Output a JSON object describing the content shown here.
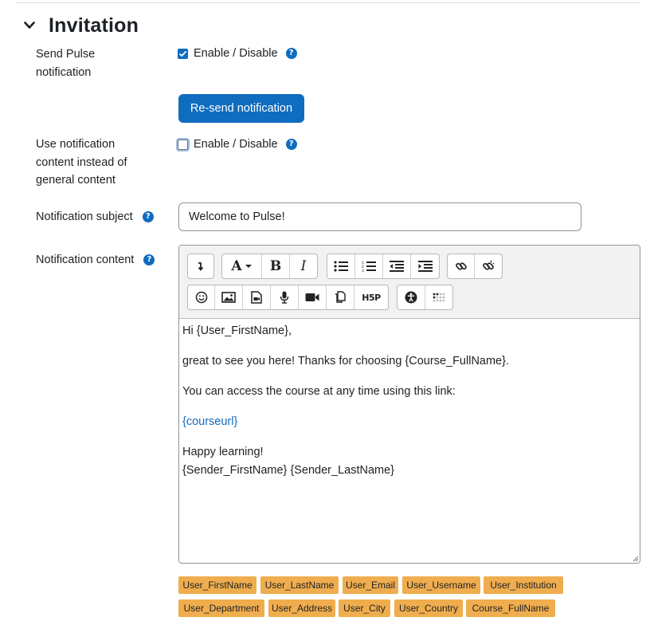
{
  "section": {
    "title": "Invitation"
  },
  "send_pulse": {
    "label": "Send Pulse notification",
    "checkbox_label": "Enable / Disable",
    "checked": true,
    "button_label": "Re-send notification"
  },
  "use_notification": {
    "label": "Use notification content instead of general content",
    "checkbox_label": "Enable / Disable",
    "checked": false
  },
  "subject": {
    "label": "Notification subject",
    "value": "Welcome to Pulse!"
  },
  "content": {
    "label": "Notification content",
    "greeting": "Hi {User_FirstName},",
    "line1": "great to see you here! Thanks for choosing {Course_FullName}.",
    "line2": "You can access the course at any time using this link:",
    "link": "{courseurl}",
    "closing": "Happy learning!",
    "signature": "{Sender_FirstName} {Sender_LastName}"
  },
  "toolbar": {
    "row1": [
      "collapse-icon",
      "font-color-icon",
      "bold-icon",
      "italic-icon",
      "unordered-list-icon",
      "ordered-list-icon",
      "outdent-icon",
      "indent-icon",
      "link-icon",
      "unlink-icon"
    ],
    "row2": [
      "emoji-icon",
      "image-icon",
      "media-icon",
      "record-audio-icon",
      "record-video-icon",
      "manage-files-icon",
      "h5p-icon",
      "accessibility-checker-icon",
      "screenreader-helper-icon"
    ],
    "h5p_text": "H5P",
    "font_letter": "A",
    "bold_letter": "B",
    "italic_letter": "I"
  },
  "placeholders": [
    "User_FirstName",
    "User_LastName",
    "User_Email",
    "User_Username",
    "User_Institution",
    "User_Department",
    "User_Address",
    "User_City",
    "User_Country",
    "Course_FullName"
  ],
  "colors": {
    "primary": "#0f6cbf",
    "tag": "#f0ad4e",
    "text": "#1d2125"
  }
}
